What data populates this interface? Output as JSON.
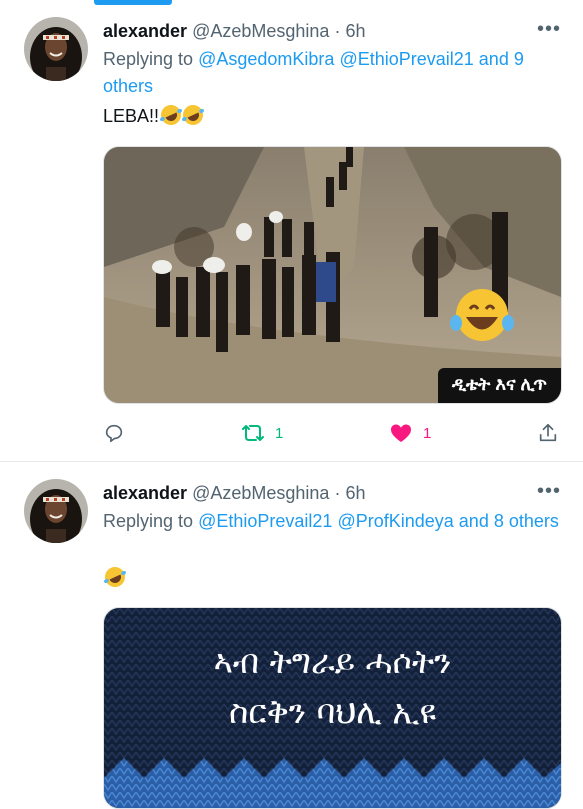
{
  "tweets": [
    {
      "display_name": "alexander",
      "handle": "@AzebMesghina",
      "dot": "·",
      "time": "6h",
      "replying_prefix": "Replying to",
      "reply_mentions": [
        "@AsgedomKibra",
        "@EthioPrevail21"
      ],
      "reply_and": "and",
      "reply_others": "9 others",
      "text": "LEBA!!",
      "media_caption": "ዲቴት እና ሊጥ",
      "retweet_count": "1",
      "like_count": "1"
    },
    {
      "display_name": "alexander",
      "handle": "@AzebMesghina",
      "dot": "·",
      "time": "6h",
      "replying_prefix": "Replying to",
      "reply_mentions": [
        "@EthioPrevail21",
        "@ProfKindeya"
      ],
      "reply_and": "and",
      "reply_others": "8 others",
      "text": "",
      "media_text_line1": "ኣብ ትግራይ ሓሶትን",
      "media_text_line2": "ስርቅን ባህሊ ኢዩ"
    }
  ],
  "icons": {
    "more": "more-horizontal-icon",
    "reply": "reply-bubble-icon",
    "retweet": "retweet-icon",
    "like": "heart-icon",
    "share": "share-icon"
  },
  "colors": {
    "accent": "#1d9bf0",
    "retweet": "#00ba7c",
    "like": "#f91880",
    "muted": "#536471"
  }
}
